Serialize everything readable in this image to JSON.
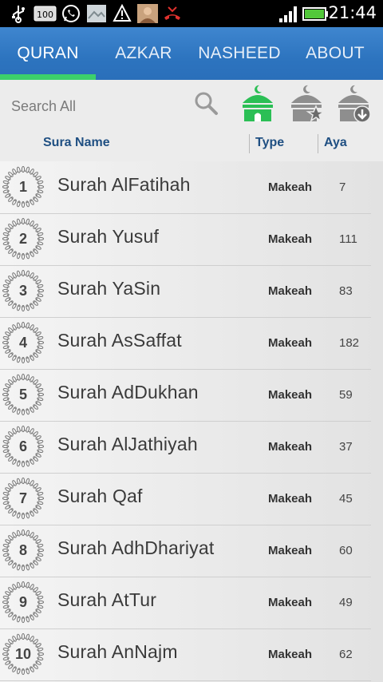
{
  "status_bar": {
    "time": "21:44",
    "battery_badge": "100",
    "icons": [
      "usb-icon",
      "battery-badge-icon",
      "whatsapp-icon",
      "gallery-icon",
      "alert-icon",
      "contact-photo-icon",
      "missed-call-icon",
      "signal-icon",
      "battery-icon"
    ]
  },
  "tabs": [
    {
      "label": "QURAN",
      "active": true
    },
    {
      "label": "AZKAR",
      "active": false
    },
    {
      "label": "NASHEED",
      "active": false
    },
    {
      "label": "ABOUT",
      "active": false
    }
  ],
  "toolbar": {
    "search_placeholder": "Search All",
    "buttons": [
      "search-icon",
      "mosque-home-icon",
      "mosque-favorite-icon",
      "mosque-download-icon"
    ],
    "accent_color": "#2bbf55"
  },
  "columns": {
    "name": "Sura Name",
    "type": "Type",
    "aya": "Aya"
  },
  "suras": [
    {
      "num": "1",
      "name": "Surah AlFatihah",
      "type": "Makeah",
      "aya": "7"
    },
    {
      "num": "2",
      "name": "Surah Yusuf",
      "type": "Makeah",
      "aya": "111"
    },
    {
      "num": "3",
      "name": "Surah YaSin",
      "type": "Makeah",
      "aya": "83"
    },
    {
      "num": "4",
      "name": "Surah AsSaffat",
      "type": "Makeah",
      "aya": "182"
    },
    {
      "num": "5",
      "name": "Surah AdDukhan",
      "type": "Makeah",
      "aya": "59"
    },
    {
      "num": "6",
      "name": "Surah AlJathiyah",
      "type": "Makeah",
      "aya": "37"
    },
    {
      "num": "7",
      "name": "Surah Qaf",
      "type": "Makeah",
      "aya": "45"
    },
    {
      "num": "8",
      "name": "Surah AdhDhariyat",
      "type": "Makeah",
      "aya": "60"
    },
    {
      "num": "9",
      "name": "Surah AtTur",
      "type": "Makeah",
      "aya": "49"
    },
    {
      "num": "10",
      "name": "Surah AnNajm",
      "type": "Makeah",
      "aya": "62"
    }
  ]
}
